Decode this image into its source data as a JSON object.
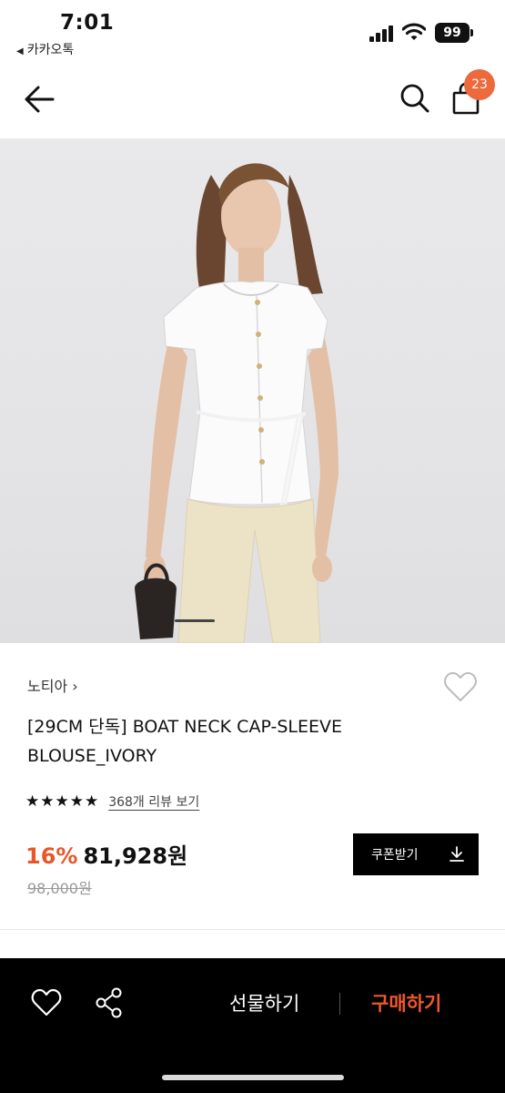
{
  "status_bar": {
    "time": "7:01",
    "back_app": "카카오톡",
    "battery": "99"
  },
  "nav": {
    "cart_count": "23",
    "accent_color": "#ec6a3c"
  },
  "gallery": {
    "image_subject": "model wearing white boat neck cap-sleeve blouse with beige pants, holding black woven bag"
  },
  "product": {
    "brand": "노티아 ›",
    "title_line1": "[29CM 단독] BOAT NECK CAP-SLEEVE",
    "title_line2": "BLOUSE_IVORY",
    "stars": "★★★★★",
    "review_link": "368개 리뷰 보기",
    "discount": "16%",
    "price": "81,928원",
    "original_price": "98,000원",
    "coupon_label": "쿠폰받기"
  },
  "bottom_bar": {
    "gift_label": "선물하기",
    "buy_label": "구매하기",
    "buy_color": "#f0572d"
  },
  "icons": [
    "signal-icon",
    "wifi-icon",
    "back-arrow-icon",
    "search-icon",
    "shopping-bag-icon",
    "heart-icon",
    "download-icon",
    "share-icon"
  ]
}
